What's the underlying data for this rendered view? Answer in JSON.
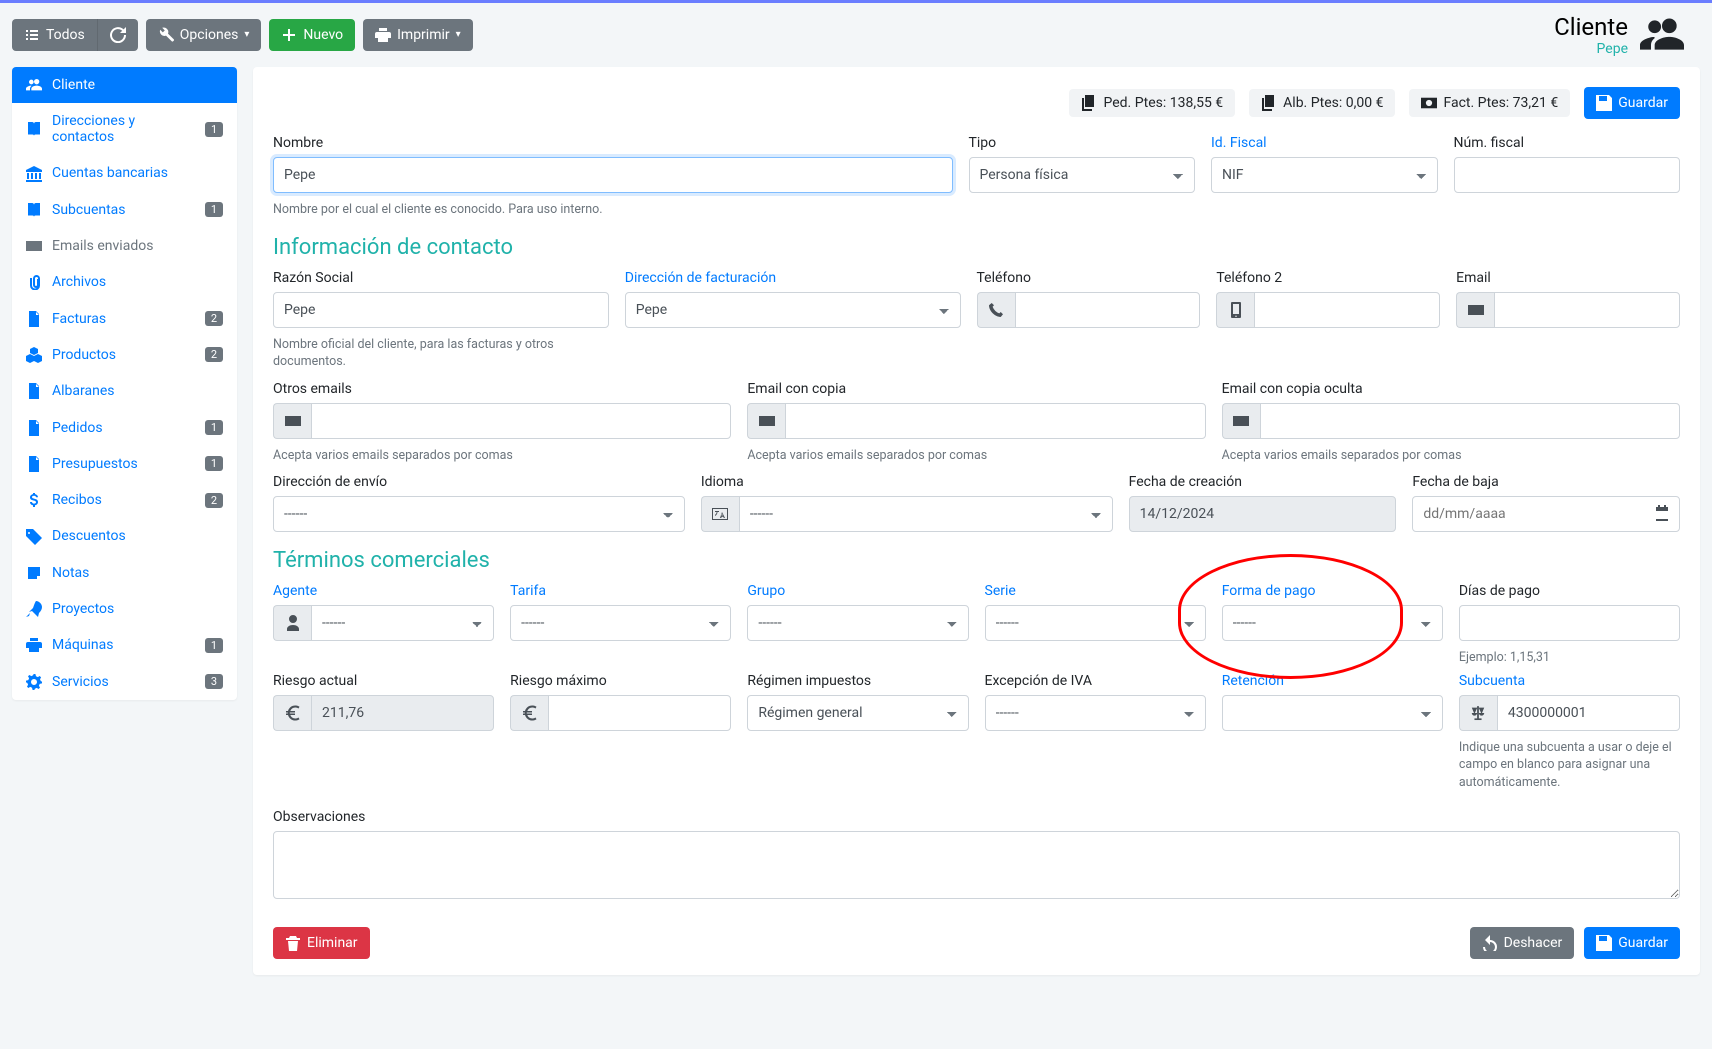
{
  "toolbar": {
    "todos": "Todos",
    "opciones": "Opciones",
    "nuevo": "Nuevo",
    "imprimir": "Imprimir"
  },
  "header": {
    "entity": "Cliente",
    "name": "Pepe"
  },
  "sidebar": [
    {
      "icon": "users",
      "label": "Cliente",
      "active": true
    },
    {
      "icon": "book",
      "label": "Direcciones y contactos",
      "badge": "1"
    },
    {
      "icon": "bank",
      "label": "Cuentas bancarias"
    },
    {
      "icon": "book",
      "label": "Subcuentas",
      "badge": "1"
    },
    {
      "icon": "mail",
      "label": "Emails enviados",
      "muted": true
    },
    {
      "icon": "clip",
      "label": "Archivos"
    },
    {
      "icon": "file",
      "label": "Facturas",
      "badge": "2"
    },
    {
      "icon": "cubes",
      "label": "Productos",
      "badge": "2"
    },
    {
      "icon": "file",
      "label": "Albaranes"
    },
    {
      "icon": "file",
      "label": "Pedidos",
      "badge": "1"
    },
    {
      "icon": "file",
      "label": "Presupuestos",
      "badge": "1"
    },
    {
      "icon": "dollar",
      "label": "Recibos",
      "badge": "2"
    },
    {
      "icon": "tag",
      "label": "Descuentos"
    },
    {
      "icon": "note",
      "label": "Notas"
    },
    {
      "icon": "rocket",
      "label": "Proyectos"
    },
    {
      "icon": "printer",
      "label": "Máquinas",
      "badge": "1"
    },
    {
      "icon": "gear",
      "label": "Servicios",
      "badge": "3"
    }
  ],
  "pills": {
    "ped": "Ped. Ptes: 138,55 €",
    "alb": "Alb. Ptes: 0,00 €",
    "fact": "Fact. Ptes: 73,21 €",
    "guardar": "Guardar"
  },
  "labels": {
    "nombre": "Nombre",
    "tipo": "Tipo",
    "idfiscal": "Id. Fiscal",
    "numfiscal": "Núm. fiscal",
    "nombre_help": "Nombre por el cual el cliente es conocido. Para uso interno.",
    "sec_contacto": "Información de contacto",
    "razon": "Razón Social",
    "dirfact": "Dirección de facturación",
    "telefono": "Teléfono",
    "telefono2": "Teléfono 2",
    "email": "Email",
    "razon_help": "Nombre oficial del cliente, para las facturas y otros documentos.",
    "otros_emails": "Otros emails",
    "email_cc": "Email con copia",
    "email_bcc": "Email con copia oculta",
    "emails_help": "Acepta varios emails separados por comas",
    "direnvio": "Dirección de envío",
    "idioma": "Idioma",
    "fcreacion": "Fecha de creación",
    "fbaja": "Fecha de baja",
    "sec_terminos": "Términos comerciales",
    "agente": "Agente",
    "tarifa": "Tarifa",
    "grupo": "Grupo",
    "serie": "Serie",
    "forma_pago": "Forma de pago",
    "dias_pago": "Días de pago",
    "dias_help": "Ejemplo: 1,15,31",
    "riesgo_actual": "Riesgo actual",
    "riesgo_max": "Riesgo máximo",
    "regimen": "Régimen impuestos",
    "excepcion": "Excepción de IVA",
    "retencion": "Retención",
    "subcuenta": "Subcuenta",
    "subcuenta_help": "Indique una subcuenta a usar o deje el campo en blanco para asignar una automáticamente.",
    "observaciones": "Observaciones",
    "eliminar": "Eliminar",
    "deshacer": "Deshacer"
  },
  "values": {
    "nombre": "Pepe",
    "tipo": "Persona física",
    "idfiscal": "NIF",
    "razon": "Pepe",
    "dirfact": "Pepe",
    "direnvio": "------",
    "idioma": "------",
    "fcreacion": "14/12/2024",
    "fbaja_placeholder": "dd/mm/aaaa",
    "agente": "------",
    "tarifa": "------",
    "grupo": "------",
    "serie": "------",
    "forma_pago": "------",
    "riesgo_actual": "211,76",
    "regimen": "Régimen general",
    "excepcion": "------",
    "subcuenta": "4300000001"
  }
}
